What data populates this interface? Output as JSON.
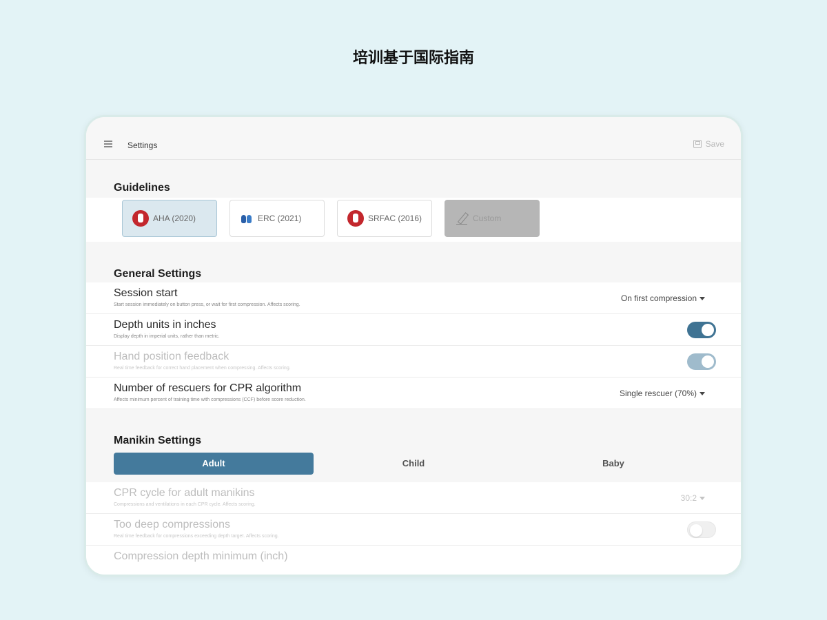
{
  "banner": "培训基于国际指南",
  "topbar": {
    "title": "Settings",
    "save_label": "Save",
    "menu_icon": "menu-icon",
    "save_icon": "save-icon"
  },
  "guidelines": {
    "title": "Guidelines",
    "options": [
      {
        "label": "AHA (2020)",
        "icon": "aha-logo-icon",
        "selected": true
      },
      {
        "label": "ERC (2021)",
        "icon": "erc-lung-icon",
        "selected": false
      },
      {
        "label": "SRFAC (2016)",
        "icon": "srfac-logo-icon",
        "selected": false
      },
      {
        "label": "Custom",
        "icon": "pencil-icon",
        "selected": false
      }
    ]
  },
  "general": {
    "title": "General Settings",
    "session_start": {
      "title": "Session start",
      "subtitle": "Start session immediately on button press, or wait for first compression. Affects scoring.",
      "value": "On first compression"
    },
    "depth_units": {
      "title": "Depth units in inches",
      "subtitle": "Display depth in imperial units, rather than metric.",
      "on": true
    },
    "hand_position": {
      "title": "Hand position feedback",
      "subtitle": "Real time feedback for correct hand placement when compressing. Affects scoring.",
      "on": true
    },
    "rescuers": {
      "title": "Number of rescuers for CPR algorithm",
      "subtitle": "Affects minimum percent of training time with compressions (CCF) before score reduction.",
      "value": "Single rescuer (70%)"
    }
  },
  "manikin": {
    "title": "Manikin Settings",
    "tabs": [
      "Adult",
      "Child",
      "Baby"
    ],
    "active_tab": "Adult",
    "cpr_cycle": {
      "title": "CPR cycle for adult manikins",
      "subtitle": "Compressions and ventilations in each CPR cycle. Affects scoring.",
      "value": "30:2"
    },
    "too_deep": {
      "title": "Too deep compressions",
      "subtitle": "Real time feedback for compressions exceeding depth target. Affects scoring.",
      "on": false
    },
    "depth_min": {
      "title": "Compression depth minimum (inch)"
    }
  },
  "colors": {
    "accent": "#447a9c",
    "background": "#e3f3f6",
    "brand_red": "#c3272d"
  }
}
